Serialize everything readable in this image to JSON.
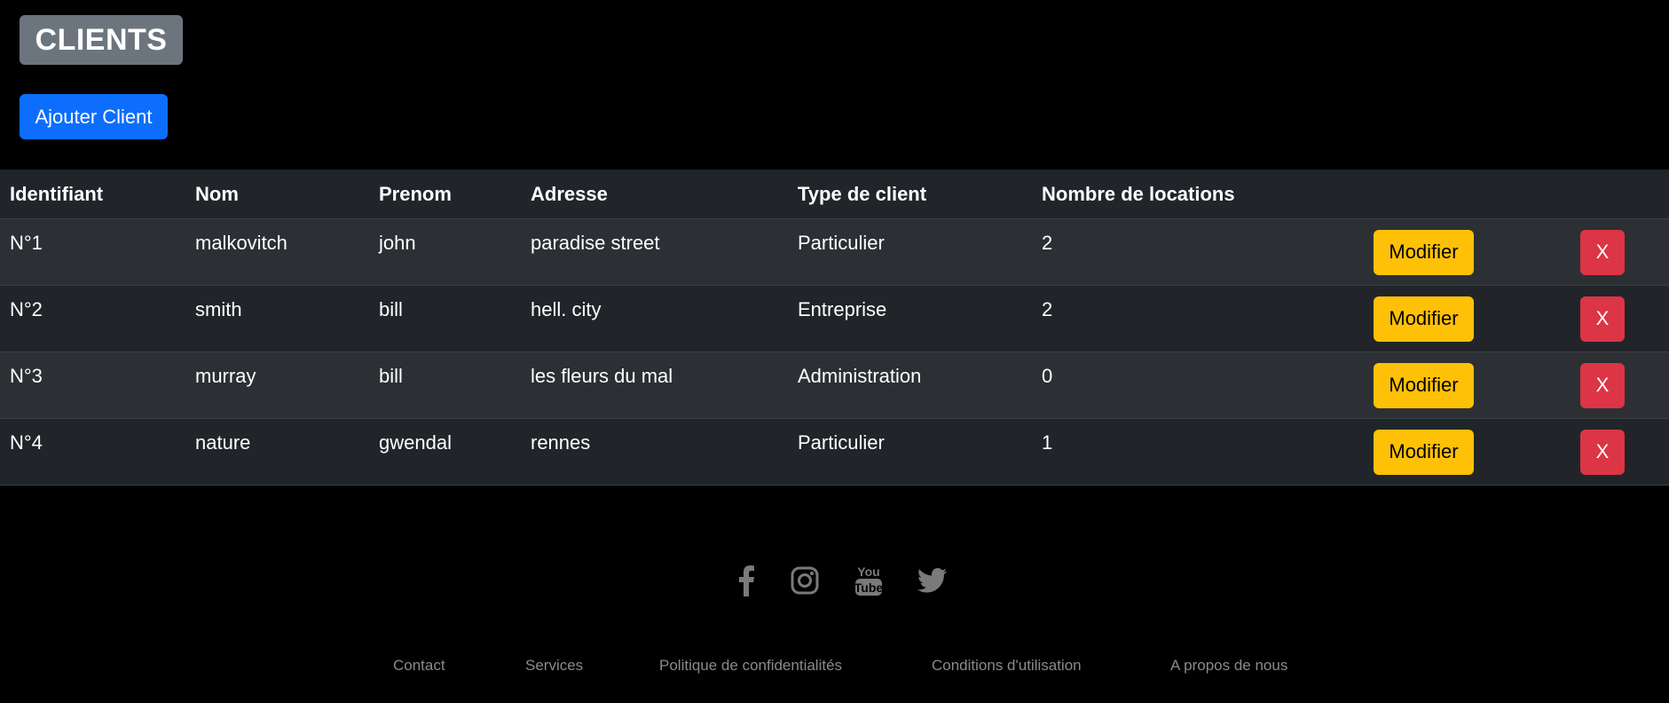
{
  "header": {
    "title": "CLIENTS",
    "add_button_label": "Ajouter Client"
  },
  "table": {
    "columns": [
      "Identifiant",
      "Nom",
      "Prenom",
      "Adresse",
      "Type de client",
      "Nombre de locations"
    ],
    "rows": [
      {
        "id": "N°1",
        "nom": "malkovitch",
        "prenom": "john",
        "adresse": "paradise street",
        "type": "Particulier",
        "locations": "2"
      },
      {
        "id": "N°2",
        "nom": "smith",
        "prenom": "bill",
        "adresse": "hell. city",
        "type": "Entreprise",
        "locations": "2"
      },
      {
        "id": "N°3",
        "nom": "murray",
        "prenom": "bill",
        "adresse": "les fleurs du mal",
        "type": "Administration",
        "locations": "0"
      },
      {
        "id": "N°4",
        "nom": "nature",
        "prenom": "gwendal",
        "adresse": "rennes",
        "type": "Particulier",
        "locations": "1"
      }
    ],
    "modify_label": "Modifier",
    "delete_label": "X"
  },
  "footer": {
    "social_icons": [
      "facebook-icon",
      "instagram-icon",
      "youtube-icon",
      "twitter-icon"
    ],
    "links": [
      "Contact",
      "Services",
      "Politique de confidentialités",
      "Conditions d'utilisation",
      "A propos de nous"
    ]
  },
  "colors": {
    "primary": "#0d6efd",
    "warning": "#ffc107",
    "danger": "#dc3545",
    "secondary": "#6c757d",
    "table_dark": "#212529",
    "table_stripe": "#2c3034",
    "icon_gray": "#7a7a7a",
    "footer_text": "#8a8a8a"
  }
}
